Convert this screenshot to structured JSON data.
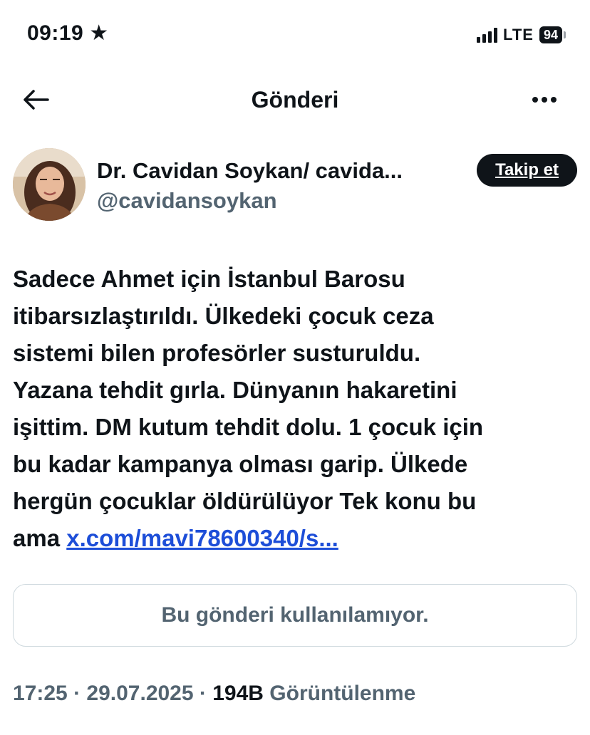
{
  "status_bar": {
    "time": "09:19",
    "focus_icon": "star-icon",
    "network": "LTE",
    "battery": "94"
  },
  "nav": {
    "title": "Gönderi",
    "back_icon": "back-arrow-icon",
    "more_icon": "more-icon"
  },
  "author": {
    "name": "Dr. Cavidan Soykan/ cavida...",
    "handle": "@cavidansoykan",
    "follow_label": "Takip et"
  },
  "tweet": {
    "lines": [
      "Sadece Ahmet için İstanbul Barosu",
      "itibarsızlaştırıldı. Ülkedeki çocuk ceza",
      "sistemi bilen profesörler susturuldu.",
      "Yazana tehdit gırla. Dünyanın hakaretini",
      "işittim. DM kutum tehdit dolu. 1 çocuk için",
      "bu kadar kampanya olması garip. Ülkede",
      "hergün çocuklar öldürülüyor Tek konu bu"
    ],
    "last_line_prefix": "ama ",
    "link_text": "x.com/mavi78600340/s..."
  },
  "quoted_unavailable": "Bu gönderi kullanılamıyor.",
  "meta": {
    "time": "17:25",
    "separator": " · ",
    "date": "29.07.2025",
    "views_count": "194B",
    "views_label": " Görüntülenme"
  },
  "colors": {
    "text": "#0f1419",
    "secondary": "#536471",
    "link": "#1d4ed8",
    "border": "#cfd9de"
  }
}
